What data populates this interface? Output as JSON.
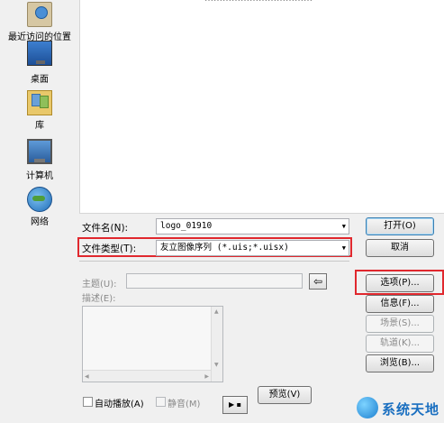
{
  "places": [
    {
      "label": "最近访问的位置",
      "icon": "recent-places-icon"
    },
    {
      "label": "桌面",
      "icon": "desktop-icon"
    },
    {
      "label": "库",
      "icon": "libraries-icon"
    },
    {
      "label": "计算机",
      "icon": "computer-icon"
    },
    {
      "label": "网络",
      "icon": "network-icon"
    }
  ],
  "file_list": {
    "partial_text": "………………………………"
  },
  "filename": {
    "label": "文件名(N):",
    "value": "logo_01910"
  },
  "filetype": {
    "label": "文件类型(T):",
    "value_name": "友立图像序列",
    "value_ext": " (*.uis;*.uisx)"
  },
  "buttons": {
    "open": "打开(O)",
    "cancel": "取消",
    "options": "选项(P)...",
    "info": "信息(F)...",
    "scene": "场景(S)...",
    "track": "轨道(K)...",
    "browse": "浏览(B)...",
    "preview": "预览(V)",
    "play": "▶ ▪"
  },
  "subject": {
    "label": "主题(U):"
  },
  "description": {
    "label": "描述(E):"
  },
  "autoplay": {
    "label": "自动播放(A)"
  },
  "mute": {
    "label": "静音(M)"
  },
  "watermark": {
    "text": "系统天地"
  },
  "colors": {
    "highlight_red": "#e0282e",
    "accent_blue": "#3c7fb1"
  }
}
